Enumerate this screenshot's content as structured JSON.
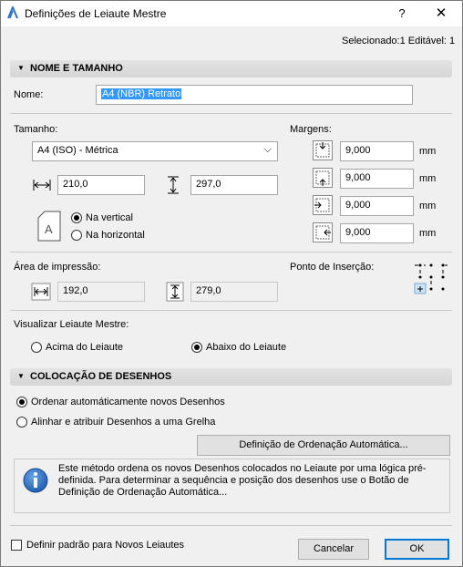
{
  "window": {
    "title": "Definições de Leiaute Mestre",
    "help_label": "?",
    "close_label": "✕"
  },
  "selection_info": "Selecionado:1 Editável: 1",
  "section_name_size": {
    "label": "NOME E TAMANHO"
  },
  "name": {
    "label": "Nome:",
    "value": "A4 (NBR) Retrato"
  },
  "size": {
    "label": "Tamanho:",
    "selected": "A4 (ISO) - Métrica",
    "width": "210,0",
    "height": "297,0",
    "orientation_vertical": "Na vertical",
    "orientation_horizontal": "Na horizontal",
    "orientation_selected": "vertical"
  },
  "margins": {
    "label": "Margens:",
    "top": "9,000",
    "bottom": "9,000",
    "left": "9,000",
    "right": "9,000",
    "unit": "mm"
  },
  "print_area": {
    "label": "Área de impressão:",
    "width": "192,0",
    "height": "279,0"
  },
  "insert_point": {
    "label": "Ponto de Inserção:"
  },
  "master_view": {
    "label": "Visualizar Leiaute Mestre:",
    "above": "Acima do Leiaute",
    "below": "Abaixo do Leiaute",
    "selected": "below"
  },
  "section_placement": {
    "label": "COLOCAÇÃO DE DESENHOS"
  },
  "placement": {
    "auto_order": "Ordenar automáticamente novos Desenhos",
    "grid_align": "Alinhar e atribuir Desenhos a uma Grelha",
    "selected": "auto",
    "auto_order_button": "Definição de Ordenação Automática...",
    "info_text": "Este método ordena os novos Desenhos colocados no Leiaute por uma lógica pré-definida. Para determinar a sequência e posição dos desenhos use o Botão de Definição de Ordenação Automática..."
  },
  "footer": {
    "default_checkbox": "Definir padrão para Novos Leiautes",
    "cancel": "Cancelar",
    "ok": "OK"
  },
  "colors": {
    "accent": "#0078d7",
    "selection": "#3399ff",
    "info_icon": "#1e5fb4"
  }
}
